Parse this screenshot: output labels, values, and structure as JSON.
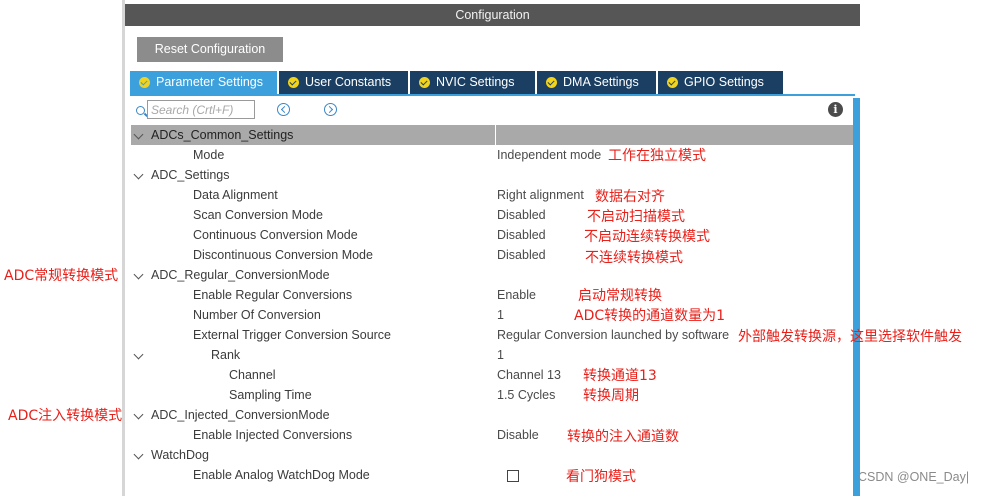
{
  "window": {
    "title": "Configuration"
  },
  "toolbar": {
    "reset_label": "Reset Configuration"
  },
  "tabs": [
    {
      "label": "Parameter Settings",
      "active": true
    },
    {
      "label": "User Constants",
      "active": false
    },
    {
      "label": "NVIC Settings",
      "active": false
    },
    {
      "label": "DMA Settings",
      "active": false
    },
    {
      "label": "GPIO Settings",
      "active": false
    }
  ],
  "search": {
    "placeholder": "Search (Crtl+F)",
    "value": ""
  },
  "icons": {
    "search": "search-icon",
    "prev": "circle-chevron-left-icon",
    "next": "circle-chevron-right-icon",
    "info": "info-icon",
    "expand": "chevron-down-icon",
    "tab_check": "check-circle-icon"
  },
  "colors": {
    "active_tab": "#3ba0dc",
    "inactive_tab": "#1b3f63",
    "tab_check": "#f2d21a",
    "annotation": "#e8201a",
    "title_bar": "#565656"
  },
  "tree": {
    "common_group": "ADCs_Common_Settings",
    "mode_label": "Mode",
    "mode_value": "Independent mode",
    "adc_group": "ADC_Settings",
    "data_alignment_label": "Data Alignment",
    "data_alignment_value": "Right alignment",
    "scan_label": "Scan Conversion Mode",
    "scan_value": "Disabled",
    "continuous_label": "Continuous Conversion Mode",
    "continuous_value": "Disabled",
    "discontinuous_label": "Discontinuous Conversion Mode",
    "discontinuous_value": "Disabled",
    "regular_group": "ADC_Regular_ConversionMode",
    "enable_regular_label": "Enable Regular Conversions",
    "enable_regular_value": "Enable",
    "num_conv_label": "Number Of Conversion",
    "num_conv_value": "1",
    "ext_trigger_label": "External Trigger Conversion Source",
    "ext_trigger_value": "Regular Conversion launched by software",
    "rank_label": "Rank",
    "rank_value": "1",
    "channel_label": "Channel",
    "channel_value": "Channel 13",
    "sampling_label": "Sampling Time",
    "sampling_value": "1.5 Cycles",
    "injected_group": "ADC_Injected_ConversionMode",
    "enable_injected_label": "Enable Injected Conversions",
    "enable_injected_value": "Disable",
    "watchdog_group": "WatchDog",
    "watchdog_label": "Enable Analog WatchDog Mode",
    "watchdog_checked": false
  },
  "annotations": {
    "mode": "工作在独立模式",
    "data_alignment": "数据右对齐",
    "scan": "不启动扫描模式",
    "continuous": "不启动连续转换模式",
    "discontinuous": "不连续转换模式",
    "regular_side": "ADC常规转换模式",
    "enable_regular": "启动常规转换",
    "num_conv": "ADC转换的通道数量为1",
    "ext_trigger": "外部触发转换源，这里选择软件触发",
    "channel": "转换通道13",
    "sampling": "转换周期",
    "injected_side": "ADC注入转换模式",
    "enable_injected": "转换的注入通道数",
    "watchdog": "看门狗模式"
  },
  "watermark": "CSDN @ONE_Day|"
}
